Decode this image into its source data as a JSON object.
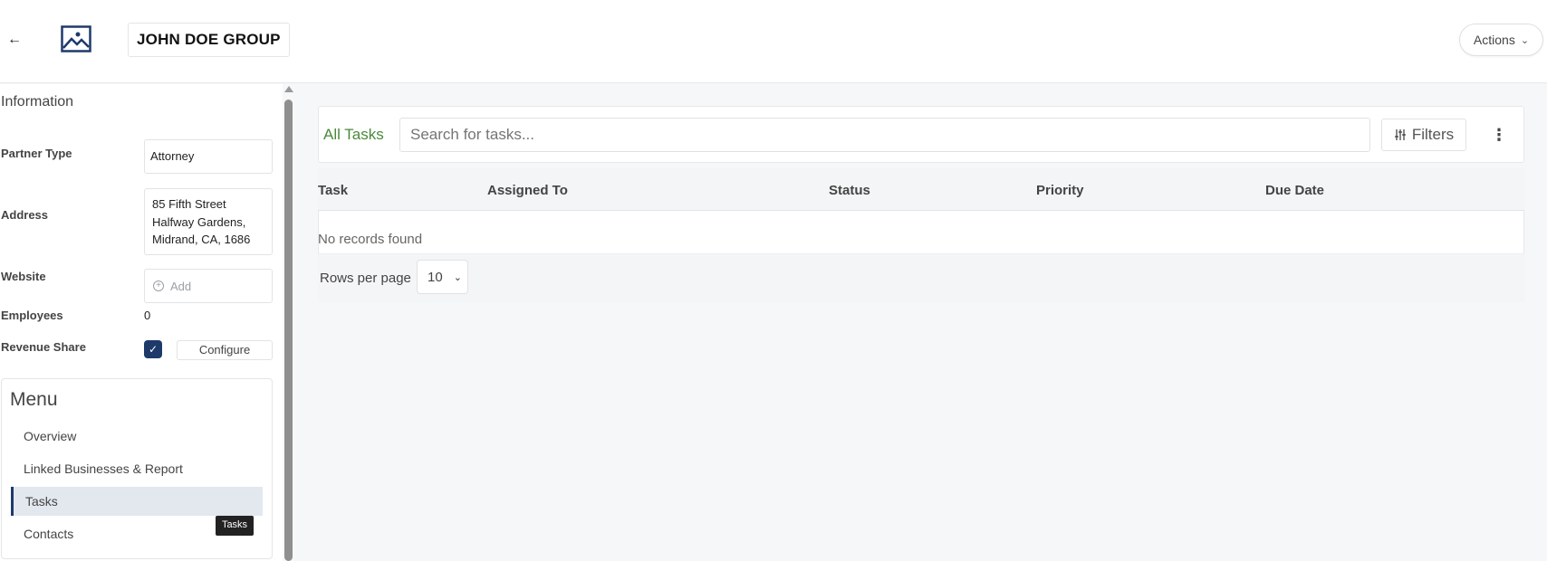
{
  "header": {
    "back_icon": "arrow-left-icon",
    "logo_icon": "image-placeholder-icon",
    "company_name": "JOHN DOE GROUP",
    "actions_label": "Actions",
    "actions_icon": "chevron-down-icon"
  },
  "info": {
    "title": "Information",
    "partner_type_label": "Partner Type",
    "partner_type_value": "Attorney",
    "address_label": "Address",
    "address_value": "85 Fifth Street\nHalfway Gardens,\nMidrand, CA, 1686",
    "website_label": "Website",
    "website_placeholder": "Add",
    "employees_label": "Employees",
    "employees_value": "0",
    "revenue_share_label": "Revenue Share",
    "revenue_share_checked": true,
    "configure_label": "Configure"
  },
  "menu": {
    "title": "Menu",
    "items": [
      {
        "label": "Overview",
        "active": false
      },
      {
        "label": "Linked Businesses & Report",
        "active": false
      },
      {
        "label": "Tasks",
        "active": true
      },
      {
        "label": "Contacts",
        "active": false
      }
    ],
    "tooltip": "Tasks"
  },
  "tasks": {
    "tab_label": "All Tasks",
    "search_placeholder": "Search for tasks...",
    "filters_label": "Filters",
    "more_icon": "kebab-vertical-icon",
    "columns": [
      "Task",
      "Assigned To",
      "Status",
      "Priority",
      "Due Date"
    ],
    "empty_text": "No records found",
    "rows_per_page_label": "Rows per page",
    "rows_per_page_value": "10"
  },
  "colors": {
    "accent": "#1e3a6b",
    "tab_green": "#4a8a3a"
  }
}
